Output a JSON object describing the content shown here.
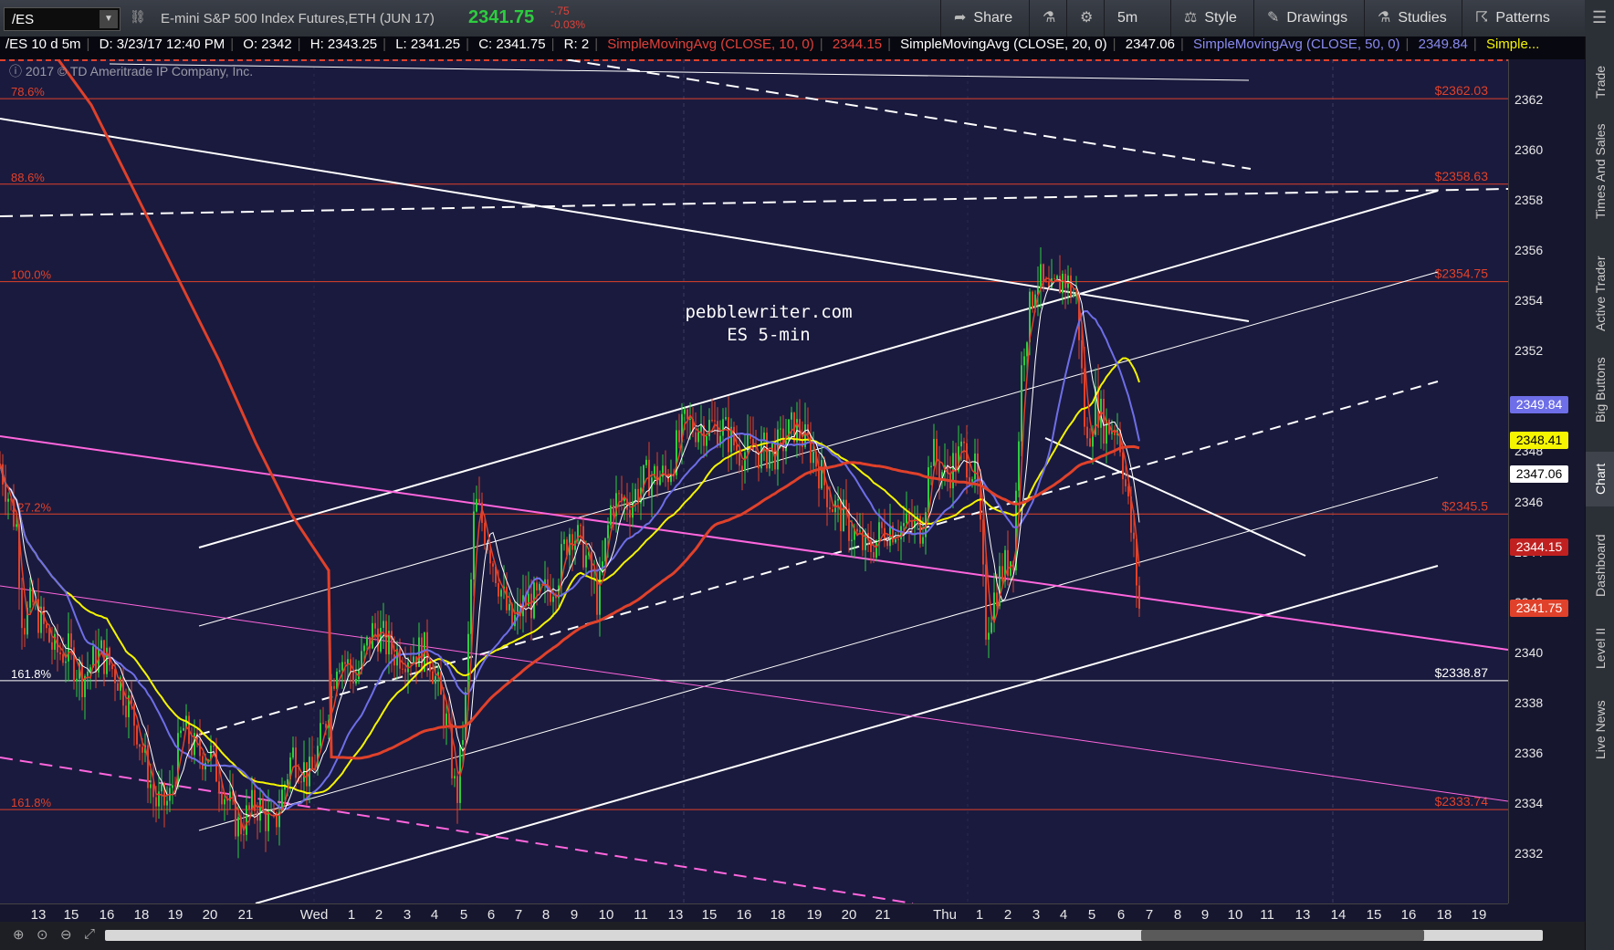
{
  "toolbar": {
    "symbol": "/ES",
    "instrument_title": "E-mini S&P 500 Index Futures,ETH (JUN 17)",
    "last_price": "2341.75",
    "net_change": "-.75",
    "pct_change": "-0.03%",
    "share_label": "Share",
    "interval_label": "5m",
    "style_label": "Style",
    "drawings_label": "Drawings",
    "studies_label": "Studies",
    "patterns_label": "Patterns",
    "colors": {
      "positive": "#2ecc40",
      "negative": "#e0413a"
    }
  },
  "infobar": {
    "period": "/ES 10 d 5m",
    "date": "D: 3/23/17 12:40 PM",
    "open": "O: 2342",
    "high": "H: 2343.25",
    "low": "L: 2341.25",
    "close": "C: 2341.75",
    "range": "R: 2",
    "sma10_label": "SimpleMovingAvg (CLOSE, 10, 0)",
    "sma10_value": "2344.15",
    "sma20_label": "SimpleMovingAvg (CLOSE, 20, 0)",
    "sma20_value": "2347.06",
    "sma50_label": "SimpleMovingAvg (CLOSE, 50, 0)",
    "sma50_value": "2349.84",
    "more_label": "Simple..."
  },
  "copyright": "2017 © TD Ameritrade IP Company, Inc.",
  "watermark": {
    "line1": "pebblewriter.com",
    "line2": "ES 5-min"
  },
  "sidebar_tabs": [
    "Trade",
    "Times And Sales",
    "Active Trader",
    "Big Buttons",
    "Chart",
    "Dashboard",
    "Level II",
    "Live News"
  ],
  "chart_data": {
    "type": "candlestick",
    "y_axis": {
      "min": 2331,
      "max": 2364,
      "ticks": [
        2332,
        2334,
        2336,
        2338,
        2340,
        2342,
        2344,
        2346,
        2348,
        2350,
        2352,
        2354,
        2356,
        2358,
        2360,
        2362
      ]
    },
    "x_axis": {
      "ticks": [
        "13",
        "15",
        "16",
        "18",
        "19",
        "20",
        "21",
        "Wed",
        "1",
        "2",
        "3",
        "4",
        "5",
        "6",
        "7",
        "8",
        "9",
        "10",
        "11",
        "13",
        "15",
        "16",
        "18",
        "19",
        "20",
        "21",
        "Thu",
        "1",
        "2",
        "3",
        "4",
        "5",
        "6",
        "7",
        "8",
        "9",
        "10",
        "11",
        "13",
        "14",
        "15",
        "16",
        "18",
        "19"
      ]
    },
    "fib_levels": [
      {
        "label": "78.6%",
        "value": 2362.03,
        "price_label": "$2362.03"
      },
      {
        "label": "88.6%",
        "value": 2358.63,
        "price_label": "$2358.63"
      },
      {
        "label": "100.0%",
        "value": 2354.75,
        "price_label": "$2354.75"
      },
      {
        "label": "127.2%",
        "value": 2345.5,
        "price_label": "$2345.5"
      },
      {
        "label": "161.8%",
        "value": 2338.87,
        "price_label": "$2338.87"
      },
      {
        "label": "161.8%",
        "value": 2333.74,
        "price_label": "$2333.74"
      }
    ],
    "price_tags": [
      {
        "value": 2349.84,
        "label": "2349.84",
        "bg": "#6e6ee8",
        "fg": "#ffffff"
      },
      {
        "value": 2348.41,
        "label": "2348.41",
        "bg": "#f5f500",
        "fg": "#000000"
      },
      {
        "value": 2347.06,
        "label": "2347.06",
        "bg": "#ffffff",
        "fg": "#000000"
      },
      {
        "value": 2344.15,
        "label": "2344.15",
        "bg": "#c02020",
        "fg": "#ffffff"
      },
      {
        "value": 2341.75,
        "label": "2341.75",
        "bg": "#e0412a",
        "fg": "#ffffff"
      }
    ],
    "path_keypoints": [
      [
        0,
        2347.5
      ],
      [
        18,
        2345
      ],
      [
        25,
        2341
      ],
      [
        35,
        2342
      ],
      [
        60,
        2340
      ],
      [
        75,
        2340
      ],
      [
        90,
        2339
      ],
      [
        110,
        2340
      ],
      [
        130,
        2339
      ],
      [
        150,
        2337
      ],
      [
        170,
        2334
      ],
      [
        185,
        2334
      ],
      [
        200,
        2337
      ],
      [
        215,
        2336
      ],
      [
        230,
        2336
      ],
      [
        250,
        2334
      ],
      [
        262,
        2333
      ],
      [
        280,
        2334
      ],
      [
        300,
        2333
      ],
      [
        320,
        2336
      ],
      [
        340,
        2335
      ],
      [
        355,
        2337
      ],
      [
        370,
        2340
      ],
      [
        390,
        2339
      ],
      [
        410,
        2341
      ],
      [
        430,
        2340
      ],
      [
        450,
        2340
      ],
      [
        470,
        2340
      ],
      [
        490,
        2337
      ],
      [
        500,
        2334
      ],
      [
        510,
        2338
      ],
      [
        520,
        2346
      ],
      [
        530,
        2345
      ],
      [
        545,
        2343
      ],
      [
        560,
        2341
      ],
      [
        575,
        2342
      ],
      [
        590,
        2342
      ],
      [
        610,
        2343
      ],
      [
        625,
        2345
      ],
      [
        640,
        2344
      ],
      [
        655,
        2342
      ],
      [
        670,
        2346
      ],
      [
        690,
        2346
      ],
      [
        710,
        2347
      ],
      [
        730,
        2347
      ],
      [
        750,
        2349
      ],
      [
        770,
        2349
      ],
      [
        790,
        2349
      ],
      [
        810,
        2348
      ],
      [
        830,
        2348
      ],
      [
        850,
        2348
      ],
      [
        870,
        2349
      ],
      [
        890,
        2348
      ],
      [
        910,
        2346
      ],
      [
        930,
        2345
      ],
      [
        950,
        2344
      ],
      [
        970,
        2345
      ],
      [
        990,
        2345
      ],
      [
        1010,
        2345
      ],
      [
        1020,
        2348
      ],
      [
        1035,
        2347
      ],
      [
        1055,
        2348
      ],
      [
        1070,
        2347
      ],
      [
        1080,
        2341
      ],
      [
        1095,
        2343
      ],
      [
        1110,
        2344
      ],
      [
        1120,
        2352
      ],
      [
        1135,
        2355
      ],
      [
        1150,
        2354
      ],
      [
        1165,
        2355
      ],
      [
        1180,
        2354
      ],
      [
        1190,
        2348
      ],
      [
        1200,
        2350
      ],
      [
        1210,
        2349
      ],
      [
        1225,
        2349
      ],
      [
        1235,
        2346
      ],
      [
        1242,
        2344
      ],
      [
        1248,
        2341.75
      ]
    ],
    "sma_colors": {
      "sma10": "#e0412a",
      "sma20": "#ffffff",
      "sma50": "#6e6ee8",
      "sma_yellow": "#f5f500",
      "sma_slow": "#e0412a"
    }
  }
}
